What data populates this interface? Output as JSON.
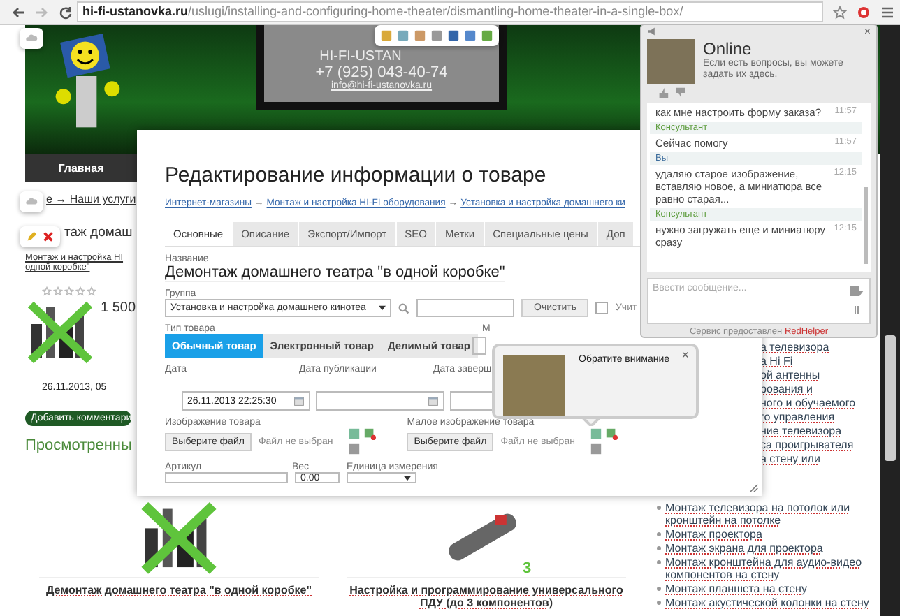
{
  "browser": {
    "url_domain": "hi-fi-ustanovka.ru",
    "url_path": "/uslugi/installing-and-configuring-home-theater/dismantling-home-theater-in-a-single-box/"
  },
  "banner": {
    "logo_text": "HI-FI-USTAN",
    "phone": "+7 (925) 043-40-74",
    "email": "info@hi-fi-ustanovka.ru"
  },
  "nav_item": "Главная",
  "page": {
    "breadcrumb": "е → Наши услуги",
    "heading": "таж домаш",
    "link_lines": [
      "Монтаж и настройка HI",
      "одной коробке\""
    ],
    "stars": 0,
    "price": "1 500",
    "date": "26.11.2013, 05",
    "comment_button": "Добавить комментари",
    "viewed_title": "Просмотренны"
  },
  "viewed": [
    {
      "kind": "crossed",
      "caption": "Демонтаж домашнего театра \"в одной коробке\""
    },
    {
      "kind": "remote",
      "badge": "3",
      "caption": "Настройка и программирование универсального ПДУ (до 3 компонентов)"
    }
  ],
  "side_fragments": [
    "а телевизора",
    "а Hi Fi",
    "ой антенны",
    "рования и",
    "ного и обучаемого",
    "го управления",
    "ние телевизора",
    "са проигрывателя",
    "а стену или"
  ],
  "side_links": [
    "Монтаж телевизора на потолок или кронштейн на потолке",
    "Монтаж проектора",
    "Монтаж экрана для проектора",
    "Монтаж кронштейна для аудио-видео компонентов на стену",
    "Монтаж планшета на стену",
    "Монтаж акустической колонки на стену"
  ],
  "modal": {
    "title": "Редактирование информации о товаре",
    "breadcrumb_separator": "→",
    "breadcrumbs": [
      "Интернет-магазины",
      "Монтаж и настройка HI-FI оборудования",
      "Установка и настройка домашнего ки"
    ],
    "tabs": [
      {
        "label": "Основные",
        "selected": true
      },
      {
        "label": "Описание",
        "selected": false
      },
      {
        "label": "Экспорт/Импорт",
        "selected": false
      },
      {
        "label": "SEO",
        "selected": false
      },
      {
        "label": "Метки",
        "selected": false
      },
      {
        "label": "Специальные цены",
        "selected": false
      },
      {
        "label": "Доп",
        "selected": false
      }
    ],
    "name_label": "Название",
    "name_value": "Демонтаж домашнего театра \"в одной коробке\"",
    "group_label": "Группа",
    "group_value": "Установка и настройка домашнего кинотеа",
    "clear_button": "Очистить",
    "checkbox": {
      "label": "Учит",
      "checked": false
    },
    "type_label": "Тип товара",
    "types": [
      {
        "label": "Обычный товар",
        "selected": true
      },
      {
        "label": "Электронный товар",
        "selected": false
      },
      {
        "label": "Делимый товар",
        "selected": false
      }
    ],
    "extra_label": "М",
    "dates": [
      {
        "label": "Дата",
        "value": "26.11.2013 22:25:30"
      },
      {
        "label": "Дата публикации"
      },
      {
        "label": "Дата заверш"
      }
    ],
    "images": [
      {
        "label": "Изображение товара",
        "button": "Выберите файл",
        "status": "Файл не выбран"
      },
      {
        "label": "Малое изображение товара",
        "button": "Выберите файл",
        "status": "Файл не выбран"
      }
    ],
    "sku_label": "Артикул",
    "weight_label": "Вес",
    "weight_value": "0.00",
    "unit_label": "Единица измерения",
    "unit_value": "—"
  },
  "popover": {
    "title": "Обратите внимание",
    "close": "×"
  },
  "chat": {
    "close": "×",
    "status": "Online",
    "intro": "Если есть вопросы, вы можете задать их здесь.",
    "messages": [
      {
        "kind": "message",
        "text": "как мне настроить форму заказа?",
        "time": "11:57"
      },
      {
        "kind": "author",
        "text": "Консультант",
        "color": "#5c9c3c"
      },
      {
        "kind": "message",
        "text": "Сейчас помогу",
        "time": "11:57"
      },
      {
        "kind": "author",
        "text": "Вы",
        "color": "#3c6c9c"
      },
      {
        "kind": "message",
        "text": "удаляю старое изображение, вставляю новое, а миниатюра все равно старая...",
        "time": "12:15"
      },
      {
        "kind": "author",
        "text": "Консультант",
        "color": "#5c9c3c"
      },
      {
        "kind": "message",
        "text": "нужно загружать еще и миниатюру сразу",
        "time": "12:15"
      }
    ],
    "placeholder": "Ввести сообщение...",
    "footer_text": "Сервис предоставлен",
    "footer_brand": "RedHelper"
  }
}
